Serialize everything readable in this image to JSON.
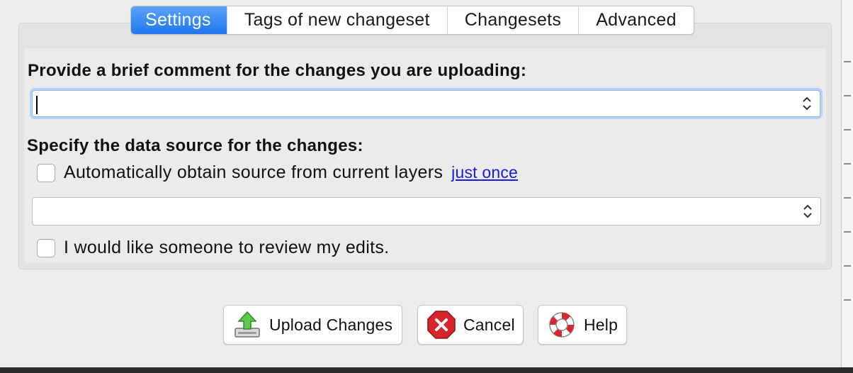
{
  "tabs": [
    {
      "label": "Settings",
      "active": true
    },
    {
      "label": "Tags of new changeset",
      "active": false
    },
    {
      "label": "Changesets",
      "active": false
    },
    {
      "label": "Advanced",
      "active": false
    }
  ],
  "settings": {
    "comment_label": "Provide a brief comment for the changes you are uploading:",
    "comment_value": "",
    "source_label": "Specify the data source for the changes:",
    "auto_source_label": "Automatically obtain source from current layers",
    "auto_source_checked": false,
    "just_once_link": "just once",
    "source_value": "",
    "review_label": "I would like someone to review my edits.",
    "review_checked": false
  },
  "buttons": {
    "upload": "Upload Changes",
    "cancel": "Cancel",
    "help": "Help"
  },
  "icons": {
    "upload": "upload-arrow-icon",
    "cancel": "cancel-x-icon",
    "help": "lifebuoy-help-icon",
    "combo_arrows": "updown-chevron-icon"
  },
  "colors": {
    "active_tab": "#1f78ef",
    "link": "#1a1adc",
    "focus_ring": "#b6d3f5"
  }
}
